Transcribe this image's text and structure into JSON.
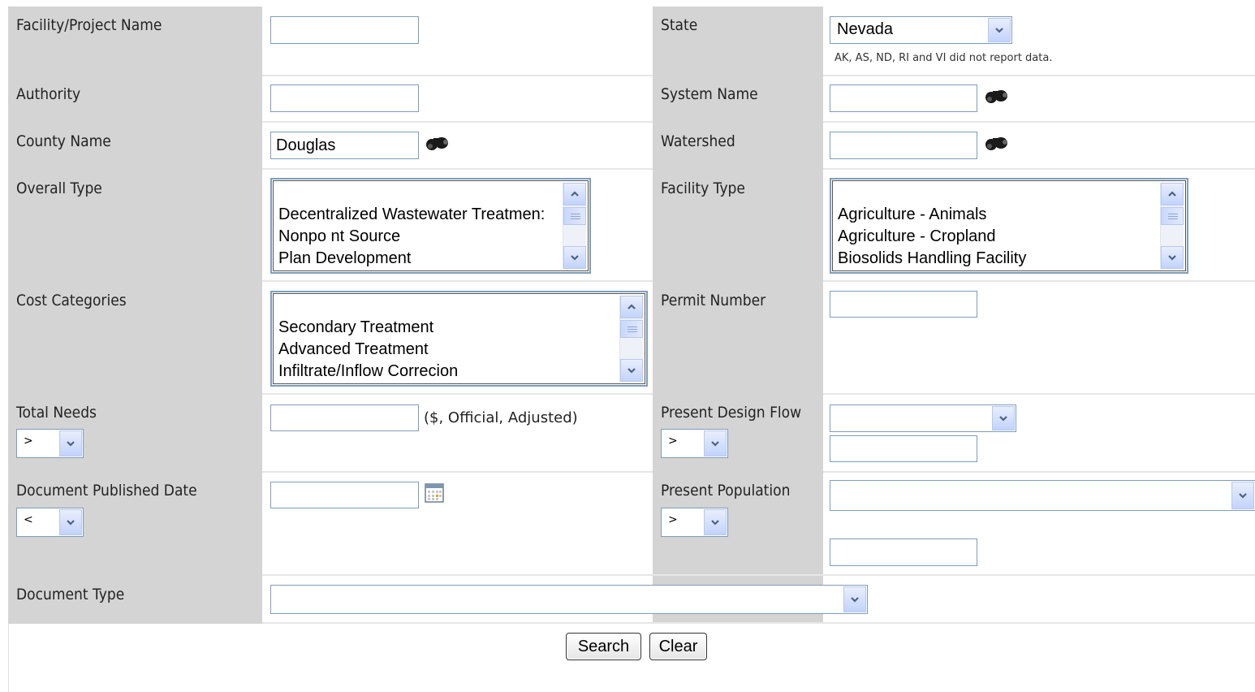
{
  "labels": {
    "facility_project_name": "Facility/Project Name",
    "state": "State",
    "authority": "Authority",
    "system_name": "System Name",
    "county_name": "County Name",
    "watershed": "Watershed",
    "overall_type": "Overall Type",
    "facility_type": "Facility Type",
    "cost_categories": "Cost Categories",
    "permit_number": "Permit Number",
    "total_needs": "Total Needs",
    "present_design_flow": "Present Design Flow",
    "document_published_date": "Document Published Date",
    "present_population": "Present Population",
    "document_type": "Document Type"
  },
  "fields": {
    "facility_project_name": "",
    "authority": "",
    "county_name": "Douglas",
    "system_name": "",
    "watershed": "",
    "permit_number": "",
    "total_needs": "",
    "present_design_flow_value": "",
    "document_published_date": "",
    "present_population_value": ""
  },
  "state": {
    "selected": "Nevada",
    "note": "AK, AS, ND, RI and VI did not report data."
  },
  "total_needs_hint": "($, Official, Adjusted)",
  "operators": {
    "total_needs": ">",
    "present_design_flow": ">",
    "document_published_date": "<",
    "present_population": ">"
  },
  "selects": {
    "present_design_flow_unit": "",
    "present_population_range": "",
    "document_type": ""
  },
  "lists": {
    "overall_type": [
      "Decentralized Wastewater Treatmen:",
      "Nonpo nt Source",
      "Plan Development"
    ],
    "facility_type": [
      "Agriculture - Animals",
      "Agriculture - Cropland",
      "Biosolids Handling Facility"
    ],
    "cost_categories": [
      "Secondary Treatment",
      "Advanced Treatment",
      "Infiltrate/Inflow Correcion"
    ]
  },
  "buttons": {
    "search": "Search",
    "clear": "Clear"
  },
  "icons": {
    "lookup": "binoculars-icon",
    "calendar": "calendar-icon"
  },
  "colors": {
    "label_bg": "#d4d4d4",
    "input_border": "#7f9db9",
    "dropdown_button": "#c3d3fd"
  }
}
